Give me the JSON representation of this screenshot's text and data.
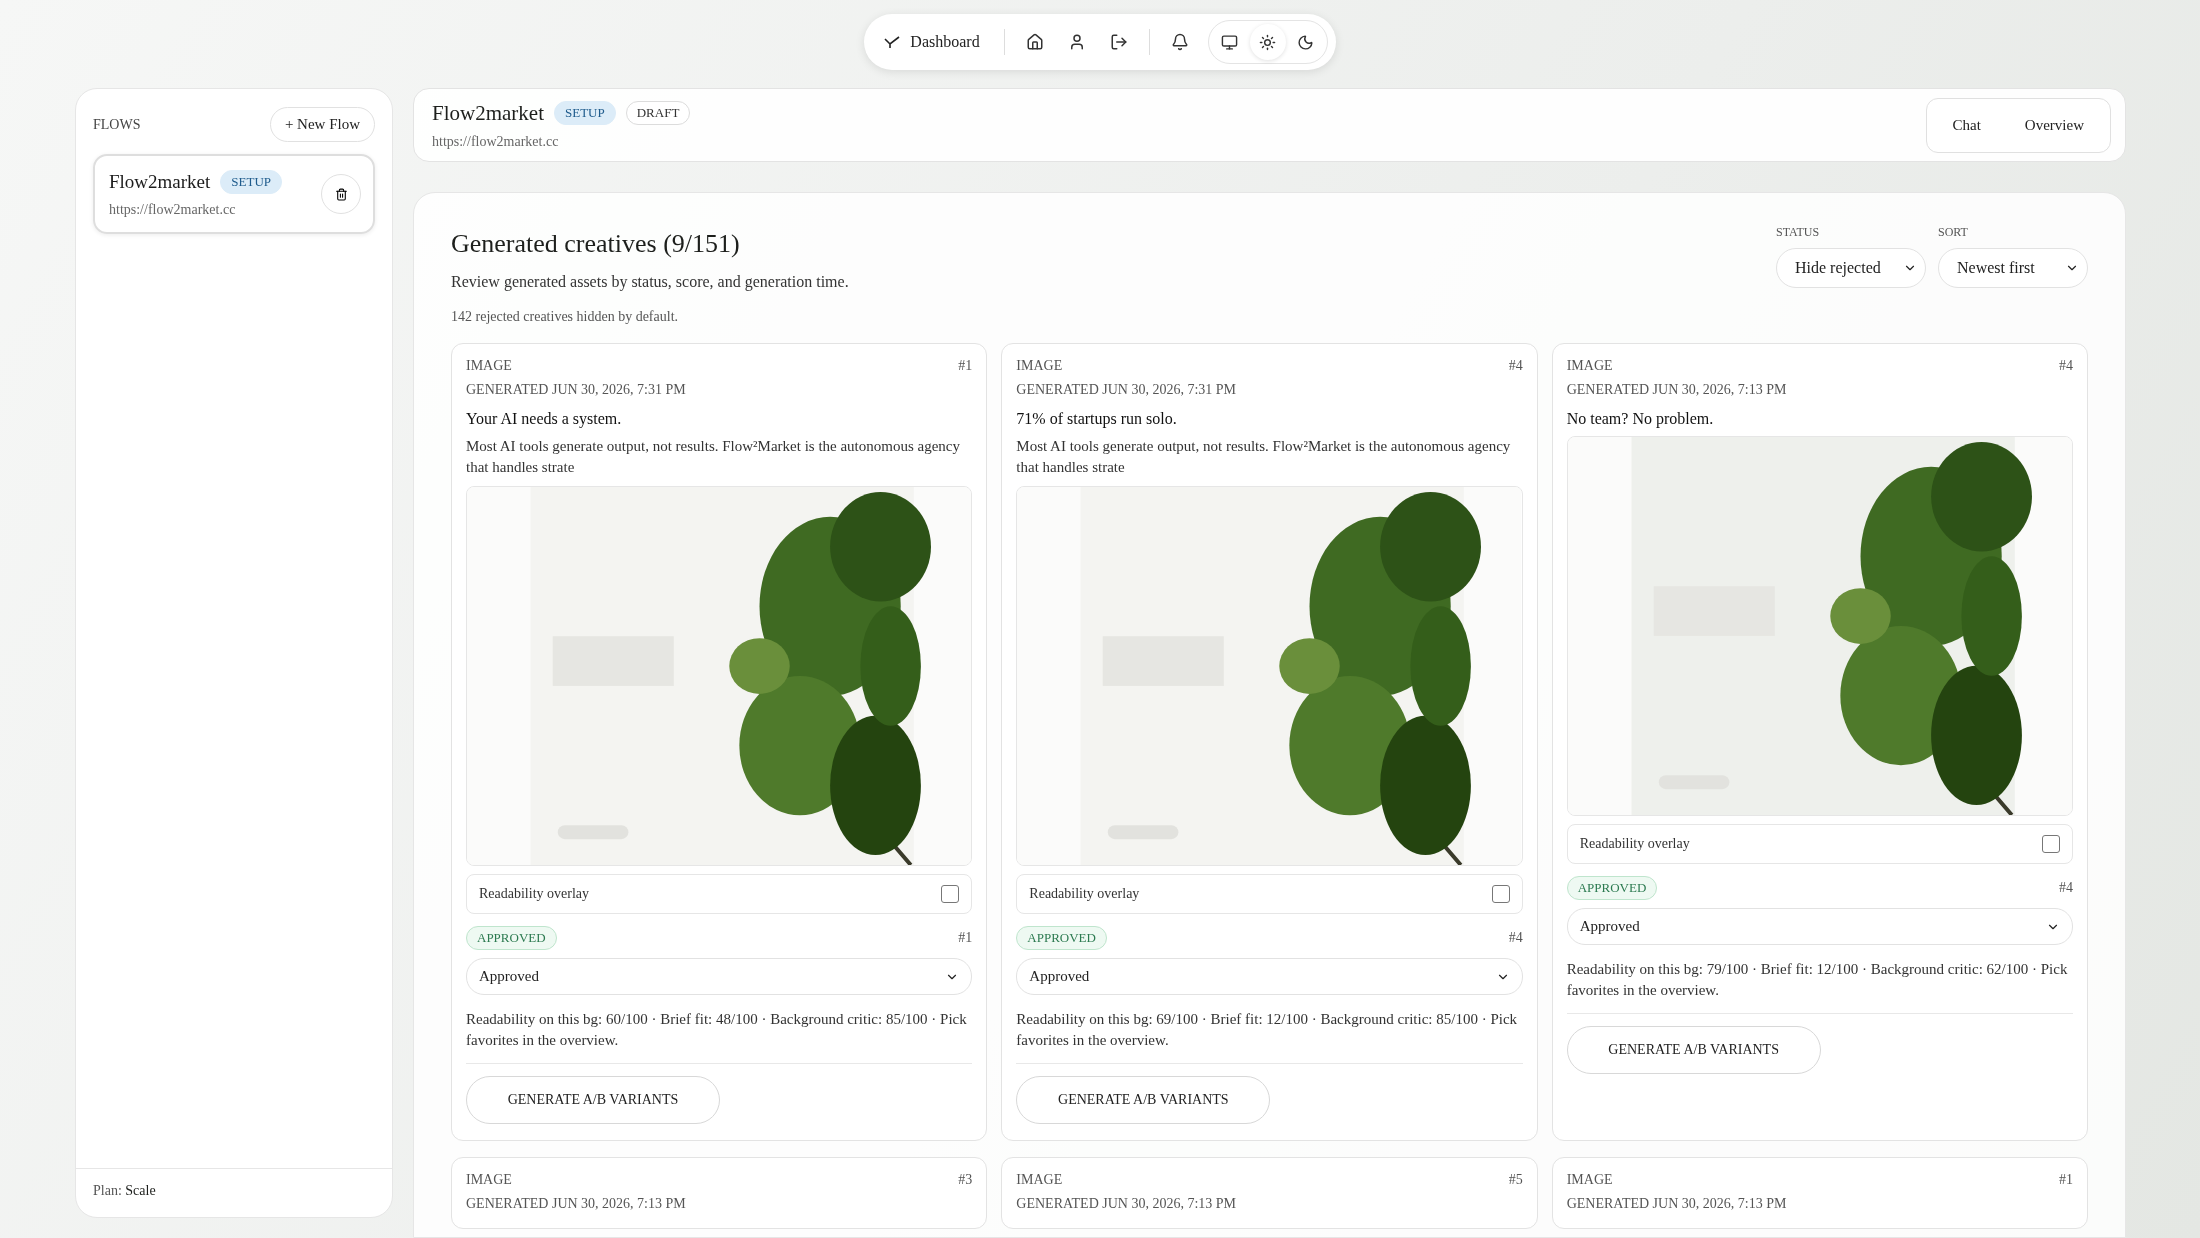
{
  "nav": {
    "brand": "Dashboard",
    "theme_modes": [
      {
        "selected": false
      },
      {
        "selected": true
      },
      {
        "selected": false
      }
    ]
  },
  "sidebar": {
    "heading": "FLOWS",
    "new_button": "+ New Flow",
    "flows": [
      {
        "name": "Flow2market",
        "badge": "SETUP",
        "url": "https://flow2market.cc",
        "selected": true
      }
    ],
    "plan_label": "Plan:",
    "plan_value": "Scale"
  },
  "header": {
    "title": "Flow2market",
    "badges": [
      {
        "label": "SETUP",
        "kind": "info"
      },
      {
        "label": "DRAFT",
        "kind": "outline"
      }
    ],
    "url": "https://flow2market.cc",
    "tabs": [
      {
        "label": "Chat",
        "selected": false
      },
      {
        "label": "Overview",
        "selected": false
      }
    ]
  },
  "main": {
    "title": "Generated creatives (9/151)",
    "subtitle": "Review generated assets by status, score, and generation time.",
    "note": "142 rejected creatives hidden by default.",
    "filters": [
      {
        "label": "STATUS",
        "value": "Hide rejected"
      },
      {
        "label": "SORT",
        "value": "Newest first"
      }
    ],
    "cards": [
      {
        "type": "IMAGE",
        "index": "#1",
        "generated": "GENERATED JUN 30, 2026, 7:31 PM",
        "headline": "Your AI needs a system.",
        "body": "Most AI tools generate output, not results. Flow²Market is the autonomous agency that handles strate",
        "overlay_label": "Readability overlay",
        "overlay_checked": false,
        "status_badge": "APPROVED",
        "status_index": "#1",
        "status_value": "Approved",
        "scores": "Readability on this bg: 60/100 · Brief fit: 48/100 · Background critic: 85/100 · Pick favorites in the overview.",
        "button": "GENERATE A/B VARIANTS"
      },
      {
        "type": "IMAGE",
        "index": "#4",
        "generated": "GENERATED JUN 30, 2026, 7:31 PM",
        "headline": "71% of startups run solo.",
        "body": "Most AI tools generate output, not results. Flow²Market is the autonomous agency that handles strate",
        "overlay_label": "Readability overlay",
        "overlay_checked": false,
        "status_badge": "APPROVED",
        "status_index": "#4",
        "status_value": "Approved",
        "scores": "Readability on this bg: 69/100 · Brief fit: 12/100 · Background critic: 85/100 · Pick favorites in the overview.",
        "button": "GENERATE A/B VARIANTS"
      },
      {
        "type": "IMAGE",
        "index": "#4",
        "generated": "GENERATED JUN 30, 2026, 7:13 PM",
        "headline": "No team? No problem.",
        "overlay_label": "Readability overlay",
        "overlay_checked": false,
        "status_badge": "APPROVED",
        "status_index": "#4",
        "status_value": "Approved",
        "scores": "Readability on this bg: 79/100 · Brief fit: 12/100 · Background critic: 62/100 · Pick favorites in the overview.",
        "button": "GENERATE A/B VARIANTS"
      },
      {
        "type": "IMAGE",
        "index": "#3",
        "generated": "GENERATED JUN 30, 2026, 7:13 PM"
      },
      {
        "type": "IMAGE",
        "index": "#5",
        "generated": "GENERATED JUN 30, 2026, 7:13 PM"
      },
      {
        "type": "IMAGE",
        "index": "#1",
        "generated": "GENERATED JUN 30, 2026, 7:13 PM"
      }
    ]
  }
}
